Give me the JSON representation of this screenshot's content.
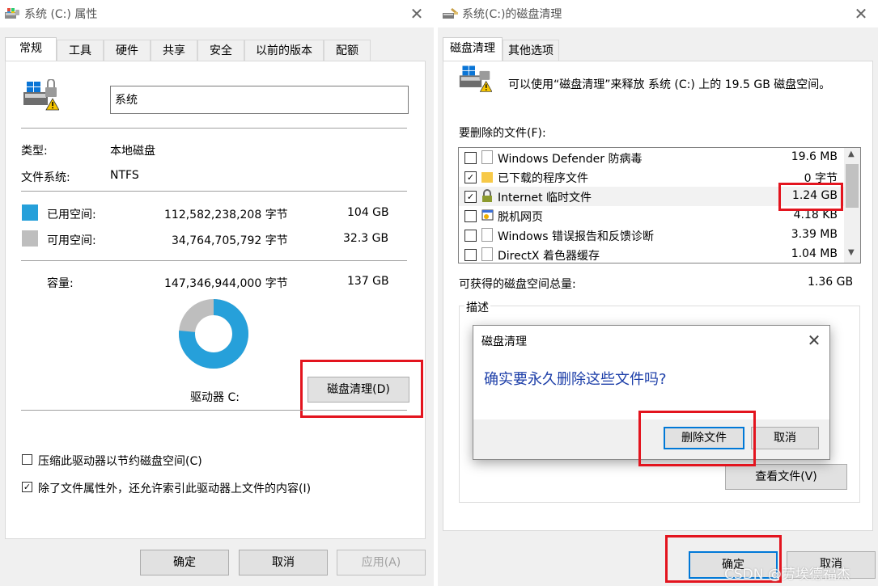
{
  "left_window": {
    "title": "系统 (C:) 属性",
    "tabs": [
      "常规",
      "工具",
      "硬件",
      "共享",
      "安全",
      "以前的版本",
      "配额"
    ],
    "drive_name": "系统",
    "type_label": "类型:",
    "type_value": "本地磁盘",
    "fs_label": "文件系统:",
    "fs_value": "NTFS",
    "used_label": "已用空间:",
    "used_bytes": "112,582,238,208 字节",
    "used_gb": "104 GB",
    "free_label": "可用空间:",
    "free_bytes": "34,764,705,792 字节",
    "free_gb": "32.3 GB",
    "capacity_label": "容量:",
    "capacity_bytes": "147,346,944,000 字节",
    "capacity_gb": "137 GB",
    "used_fraction": 0.764,
    "drive_label": "驱动器 C:",
    "cleanup_button": "磁盘清理(D)",
    "compress_label": "压缩此驱动器以节约磁盘空间(C)",
    "compress_checked": false,
    "index_label": "除了文件属性外，还允许索引此驱动器上文件的内容(I)",
    "index_checked": true,
    "ok": "确定",
    "cancel": "取消",
    "apply": "应用(A)",
    "colors": {
      "used": "#26a0da",
      "free": "#bebebe"
    }
  },
  "right_window": {
    "title": "系统(C:)的磁盘清理",
    "tabs": [
      "磁盘清理",
      "其他选项"
    ],
    "intro": "可以使用“磁盘清理”来释放 系统 (C:) 上的 19.5 GB 磁盘空间。",
    "files_label": "要删除的文件(F):",
    "files": [
      {
        "name": "Windows Defender 防病毒",
        "size": "19.6 MB",
        "checked": false,
        "icon": "document-icon"
      },
      {
        "name": "已下载的程序文件",
        "size": "0 字节",
        "checked": true,
        "icon": "folder-icon"
      },
      {
        "name": "Internet 临时文件",
        "size": "1.24 GB",
        "checked": true,
        "icon": "lock-icon"
      },
      {
        "name": "脱机网页",
        "size": "4.18 KB",
        "checked": false,
        "icon": "webpage-icon"
      },
      {
        "name": "Windows 错误报告和反馈诊断",
        "size": "3.39 MB",
        "checked": false,
        "icon": "document-icon"
      },
      {
        "name": "DirectX 着色器缓存",
        "size": "1.04 MB",
        "checked": false,
        "icon": "document-icon"
      }
    ],
    "total_label": "可获得的磁盘空间总量:",
    "total_value": "1.36 GB",
    "desc_label": "描述",
    "view_files": "查看文件(V)",
    "ok": "确定",
    "cancel": "取消"
  },
  "dialog": {
    "title": "磁盘清理",
    "message": "确实要永久删除这些文件吗?",
    "delete_button": "删除文件",
    "cancel_button": "取消"
  },
  "watermark": "CSDN @劳埃德福杰"
}
